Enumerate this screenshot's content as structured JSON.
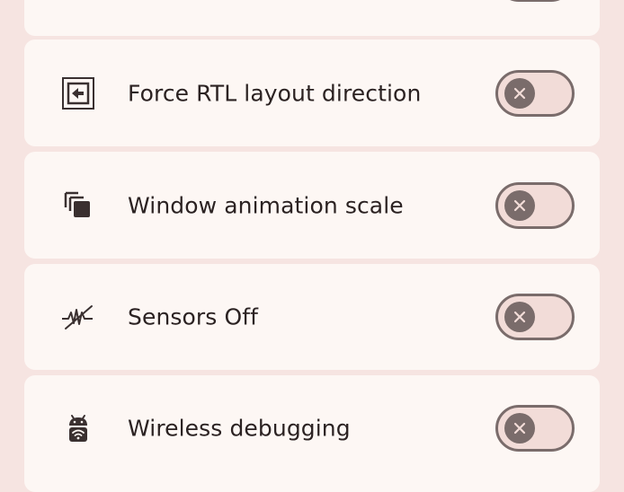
{
  "settings": [
    {
      "label": "Force RTL layout direction",
      "icon": "rtl-layout-icon",
      "toggle_state": "off"
    },
    {
      "label": "Window animation scale",
      "icon": "window-animation-icon",
      "toggle_state": "off"
    },
    {
      "label": "Sensors Off",
      "icon": "sensors-off-icon",
      "toggle_state": "off"
    },
    {
      "label": "Wireless debugging",
      "icon": "android-wifi-icon",
      "toggle_state": "off"
    }
  ],
  "colors": {
    "background": "#f6e4e1",
    "card": "#fdf7f4",
    "toggle_track": "#f2dcd8",
    "toggle_knob": "#7a6c6b",
    "text": "#2b2222"
  }
}
